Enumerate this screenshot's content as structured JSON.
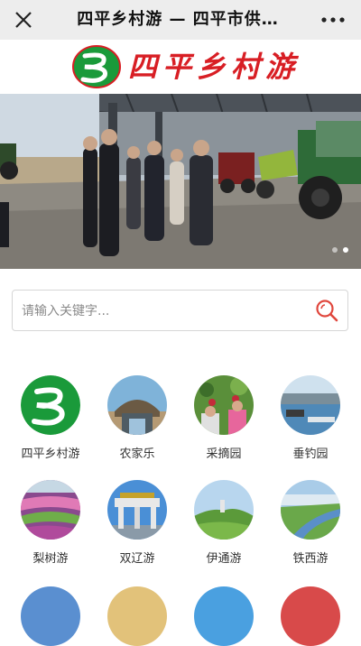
{
  "header": {
    "title": "四平乡村游 — 四平市供…"
  },
  "brand": {
    "name": "四平乡村游"
  },
  "banner": {
    "slide_count": 2,
    "active_slide": 2
  },
  "search": {
    "placeholder": "请输入关键字..."
  },
  "categories": [
    {
      "label": "四平乡村游",
      "icon": "logo"
    },
    {
      "label": "农家乐",
      "icon": "farmhouse"
    },
    {
      "label": "采摘园",
      "icon": "fruit-picking"
    },
    {
      "label": "垂钓园",
      "icon": "fishing"
    },
    {
      "label": "梨树游",
      "icon": "flower-field"
    },
    {
      "label": "双辽游",
      "icon": "archway"
    },
    {
      "label": "伊通游",
      "icon": "mountain"
    },
    {
      "label": "铁西游",
      "icon": "river"
    }
  ],
  "colors": {
    "brand_red": "#d81e24",
    "brand_green": "#1a9a3a",
    "topbar": "#ededed"
  }
}
